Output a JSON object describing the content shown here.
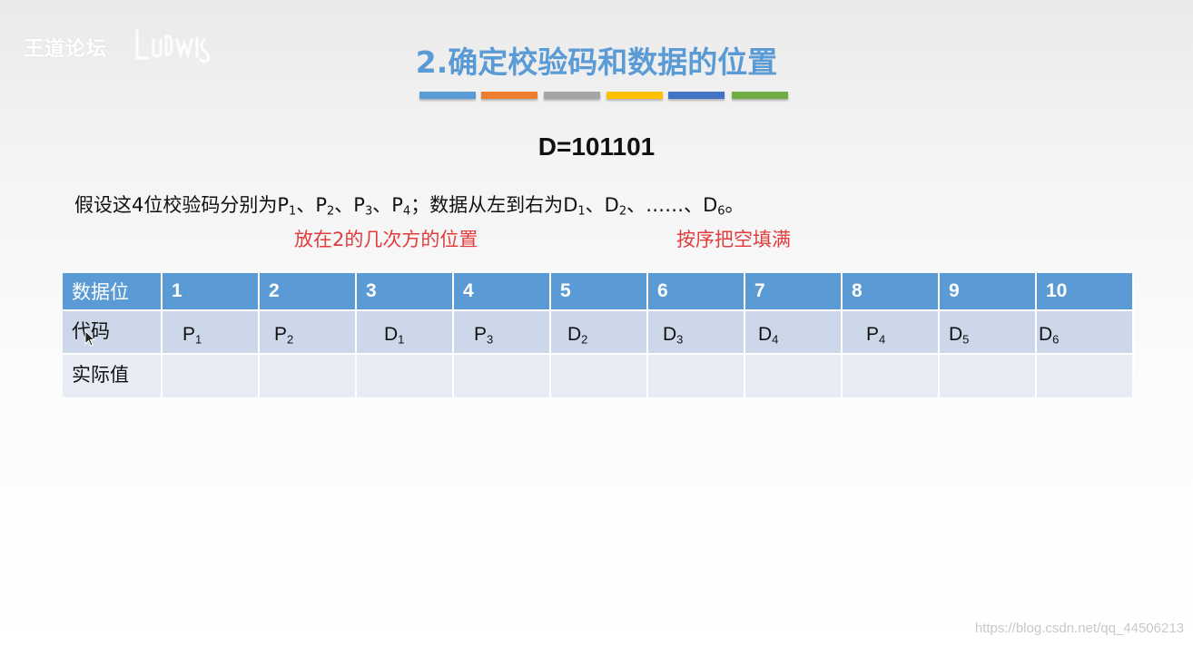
{
  "logo": {
    "text": "王道论坛",
    "signature": "Ludwig"
  },
  "slide": {
    "title": "2.确定校验码和数据的位置",
    "title_color": "#5b9bd5",
    "bar_colors": [
      "#5b9bd5",
      "#ed7d31",
      "#a5a5a5",
      "#ffc000",
      "#4472c4",
      "#70ad47"
    ],
    "formula": "D=101101",
    "assumption": {
      "lead": "假设这4位校验码分别为",
      "p": [
        "P",
        "P",
        "P",
        "P"
      ],
      "p_sub": [
        "1",
        "2",
        "3",
        "4"
      ],
      "mid": "；数据从左到右为",
      "d": [
        "D",
        "D",
        "D"
      ],
      "d_sub": [
        "1",
        "2",
        "6"
      ],
      "sep": "、",
      "ellipsis": "……",
      "end": "。"
    },
    "notes": {
      "left": "放在2的几次方的位置",
      "right": "按序把空填满",
      "color": "#e03c3c"
    }
  },
  "table": {
    "header_label": "数据位",
    "positions": [
      "1",
      "2",
      "3",
      "4",
      "5",
      "6",
      "7",
      "8",
      "9",
      "10"
    ],
    "code_label": "代码",
    "codes": [
      {
        "letter": "P",
        "sub": "1"
      },
      {
        "letter": "P",
        "sub": "2"
      },
      {
        "letter": "D",
        "sub": "1"
      },
      {
        "letter": "P",
        "sub": "3"
      },
      {
        "letter": "D",
        "sub": "2"
      },
      {
        "letter": "D",
        "sub": "3"
      },
      {
        "letter": "D",
        "sub": "4"
      },
      {
        "letter": "P",
        "sub": "4"
      },
      {
        "letter": "D",
        "sub": "5"
      },
      {
        "letter": "D",
        "sub": "6"
      }
    ],
    "value_label": "实际值",
    "values": [
      "",
      "",
      "",
      "",
      "",
      "",
      "",
      "",
      "",
      ""
    ],
    "colors": {
      "header": "#5b9bd5",
      "row1": "#ccd8ea",
      "row2": "#e7ecf5"
    }
  },
  "watermark": "https://blog.csdn.net/qq_44506213"
}
